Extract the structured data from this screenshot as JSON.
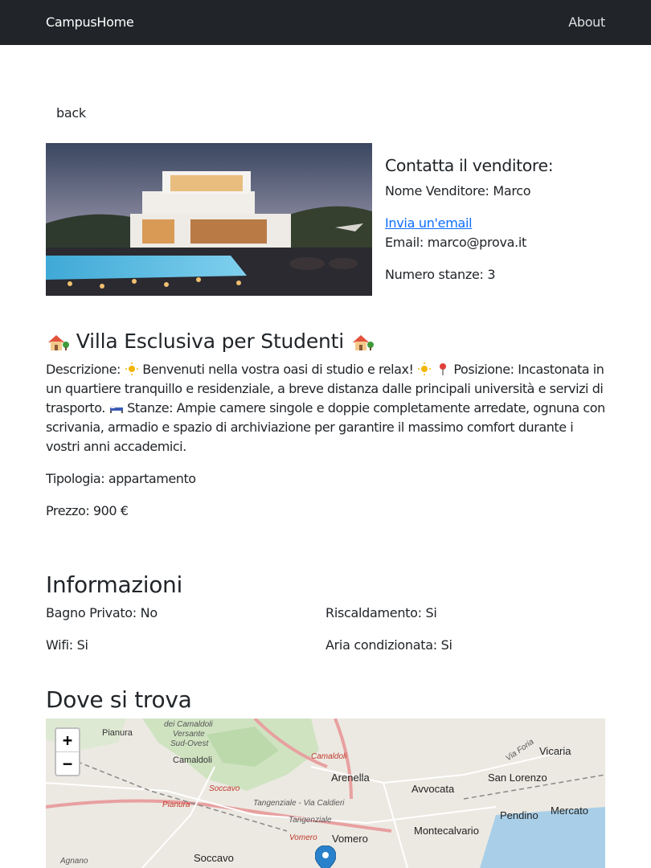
{
  "nav": {
    "brand": "CampusHome",
    "about": "About"
  },
  "back_label": "back",
  "contact": {
    "title": "Contatta il venditore:",
    "name": "Nome Venditore: Marco",
    "email_link": "Invia un'email",
    "email": "Email: marco@prova.it",
    "rooms": "Numero stanze: 3"
  },
  "listing": {
    "title": "Villa Esclusiva per Studenti",
    "desc_label": "Descrizione:",
    "desc_1": "Benvenuti nella vostra oasi di studio e relax!",
    "desc_2": "Posizione: Incastonata in un quartiere tranquillo e residenziale, a breve distanza dalle principali università e servizi di trasporto.",
    "desc_3": "Stanze: Ampie camere singole e doppie completamente arredate, ognuna con scrivania, armadio e spazio di archiviazione per garantire il massimo comfort durante i vostri anni accademici.",
    "type": "Tipologia: appartamento",
    "price": "Prezzo: 900 €"
  },
  "info": {
    "title": "Informazioni",
    "bathroom": "Bagno Privato: No",
    "heating": "Riscaldamento: Si",
    "wifi": "Wifi: Si",
    "ac": "Aria condizionata: Si"
  },
  "map": {
    "title": "Dove si trova",
    "zoom_in": "+",
    "zoom_out": "−",
    "labels": {
      "pianura_top": "Pianura",
      "camaldoli_area": "dei Camaldoli",
      "versante": "Versante",
      "sud_ovest": "Sud-Ovest",
      "camaldoli": "Camaldoli",
      "camaldoli_red": "Camaldoli",
      "soccavo_red": "Soccavo",
      "pianura_red": "Pianura",
      "tangenziale": "Tangenziale - Via Caldieri",
      "tangenziale2": "Tangenziale",
      "vomero_red": "Vomero",
      "arenella": "Arenella",
      "avvocata": "Avvocata",
      "san_lorenzo": "San Lorenzo",
      "vicaria": "Vicaria",
      "via_foria": "Via Foria",
      "pendino": "Pendino",
      "mercato": "Mercato",
      "montecalvario": "Montecalvario",
      "vomero": "Vomero",
      "soccavo": "Soccavo",
      "agnano": "Agnano"
    }
  },
  "colors": {
    "navbar": "#212529",
    "link": "#0d6efd",
    "marker": "#2a81cb"
  }
}
